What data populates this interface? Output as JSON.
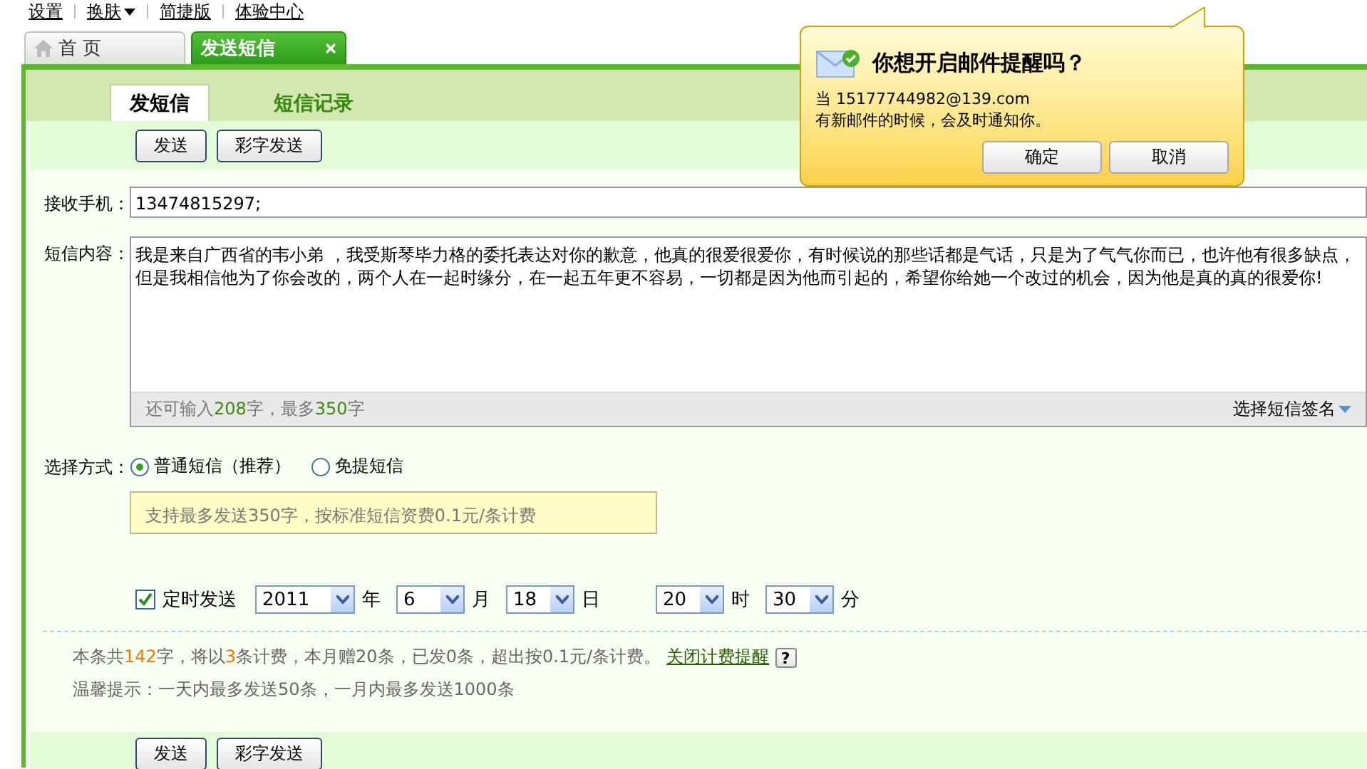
{
  "top_links": [
    {
      "label": "设置",
      "has_menu": false
    },
    {
      "label": "换肤",
      "has_menu": true
    },
    {
      "label": "简捷版",
      "has_menu": false
    },
    {
      "label": "体验中心",
      "has_menu": false
    }
  ],
  "tabs": [
    {
      "label": "首 页",
      "selected": false,
      "closable": false
    },
    {
      "label": "发送短信",
      "selected": true,
      "closable": true
    }
  ],
  "subtabs": [
    {
      "label": "发短信",
      "selected": true
    },
    {
      "label": "短信记录",
      "selected": false
    }
  ],
  "toolbar_buttons": [
    "发送",
    "彩字发送"
  ],
  "recipient": {
    "label": "接收手机：",
    "value": "13474815297;"
  },
  "message": {
    "label": "短信内容：",
    "value": "我是来自广西省的韦小弟 ，我受斯琴毕力格的委托表达对你的歉意，他真的很爱很爱你，有时候说的那些话都是气话，只是为了气气你而已，也许他有很多缺点，但是我相信他为了你会改的，两个人在一起时缘分，在一起五年更不容易，一切都是因为他而引起的，希望你给她一个改过的机会，因为他是真的真的很爱你!",
    "counter": [
      {
        "text": "还可输入",
        "highlight": false
      },
      {
        "text": "208",
        "highlight": true
      },
      {
        "text": "字，最多",
        "highlight": false
      },
      {
        "text": "350",
        "highlight": true
      },
      {
        "text": "字",
        "highlight": false
      }
    ],
    "signature": "选择短信签名"
  },
  "send_mode": {
    "label": "选择方式：",
    "options": [
      {
        "label": "普通短信（推荐）",
        "selected": true
      },
      {
        "label": "免提短信",
        "selected": false
      }
    ],
    "hint": "支持最多发送350字，按标准短信资费0.1元/条计费"
  },
  "schedule": {
    "label": "定时发送",
    "checked": true,
    "fields": [
      {
        "value": "2011",
        "unit": "年"
      },
      {
        "value": "6",
        "unit": "月"
      },
      {
        "value": "18",
        "unit": "日"
      },
      {
        "value": "20",
        "unit": "时"
      },
      {
        "value": "30",
        "unit": "分"
      }
    ]
  },
  "fee_notice": {
    "segments": [
      {
        "text": "本条共",
        "highlight": false
      },
      {
        "text": "142",
        "highlight": true
      },
      {
        "text": "字，将以",
        "highlight": false
      },
      {
        "text": "3",
        "highlight": true
      },
      {
        "text": "条计费，本月赠20条，已发0条，超出按0.1元/条计费。",
        "highlight": false
      }
    ],
    "link": "关闭计费提醒",
    "help": "?"
  },
  "tip": "温馨提示：一天内最多发送50条，一月内最多发送1000条",
  "bottom_buttons": [
    "发送",
    "彩字发送"
  ],
  "popup": {
    "title": "你想开启邮件提醒吗？",
    "line_1": "当 15177744982@139.com",
    "line_2": "有新邮件的时候，会及时通知你。",
    "buttons": [
      "确定",
      "取消"
    ]
  }
}
